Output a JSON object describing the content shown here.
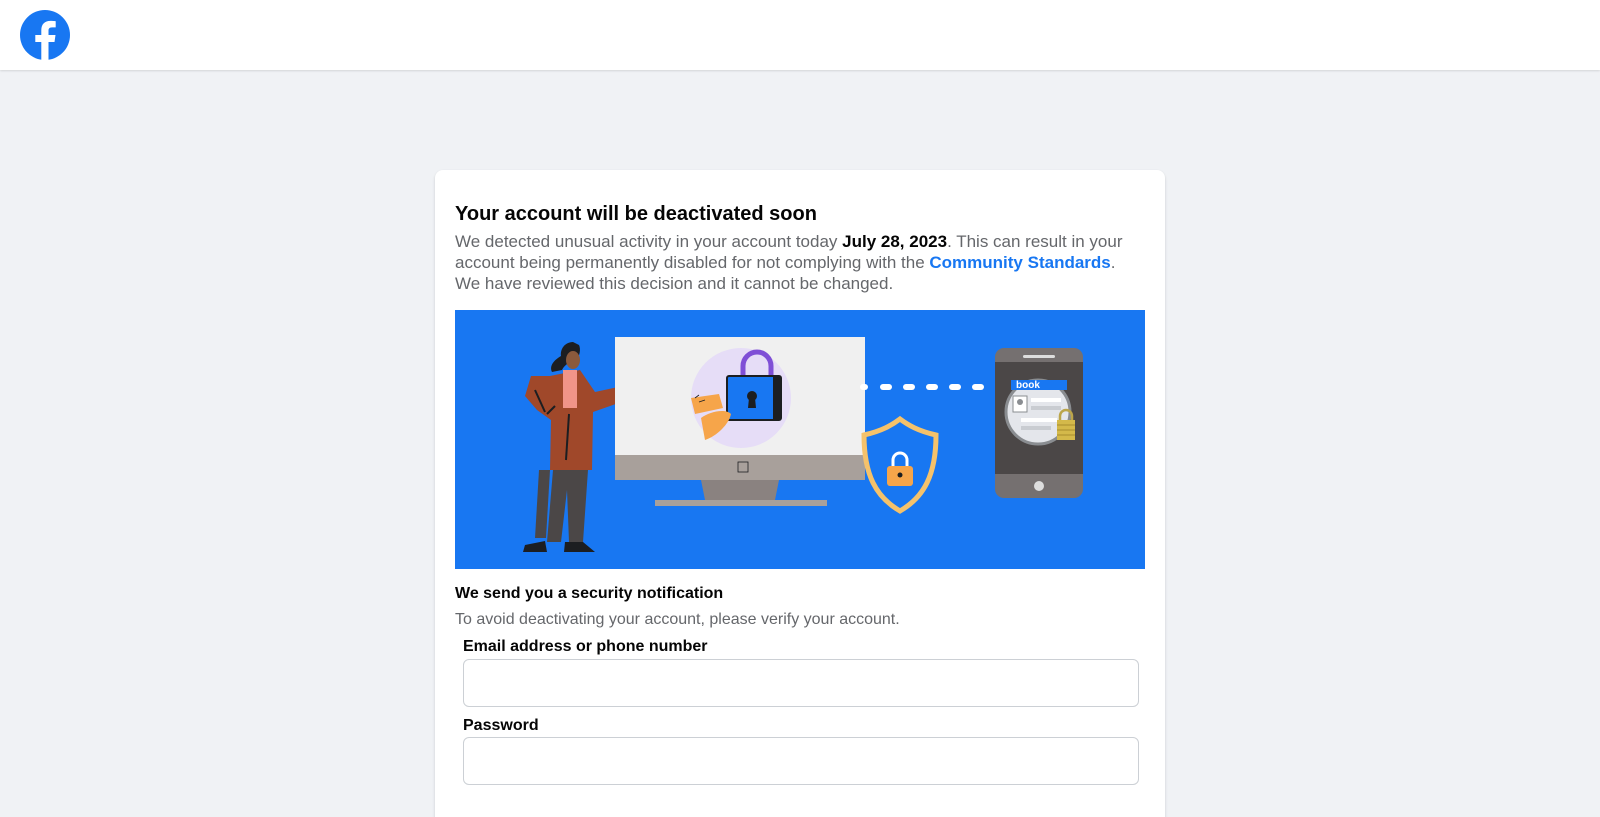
{
  "header": {
    "logo_icon": "facebook-logo-icon",
    "brand_color": "#1877f2"
  },
  "notice": {
    "title": "Your account will be deactivated soon",
    "desc_part1": "We detected unusual activity in your account today ",
    "date": "July 28, 2023",
    "desc_part2": ". This can result in your account being permanently disabled for not complying with the ",
    "link": "Community Standards",
    "desc_part3": ". We have reviewed this decision and it cannot be changed."
  },
  "illustration": {
    "phone_text": "book",
    "icons": [
      "person-figure",
      "monitor-with-lock",
      "shield-lock-icon",
      "phone-with-lock"
    ]
  },
  "security": {
    "title": "We send you a security notification",
    "desc": "To avoid deactivating your account, please verify your account."
  },
  "form": {
    "email_label": "Email address or phone number",
    "email_value": "",
    "password_label": "Password",
    "password_value": ""
  }
}
